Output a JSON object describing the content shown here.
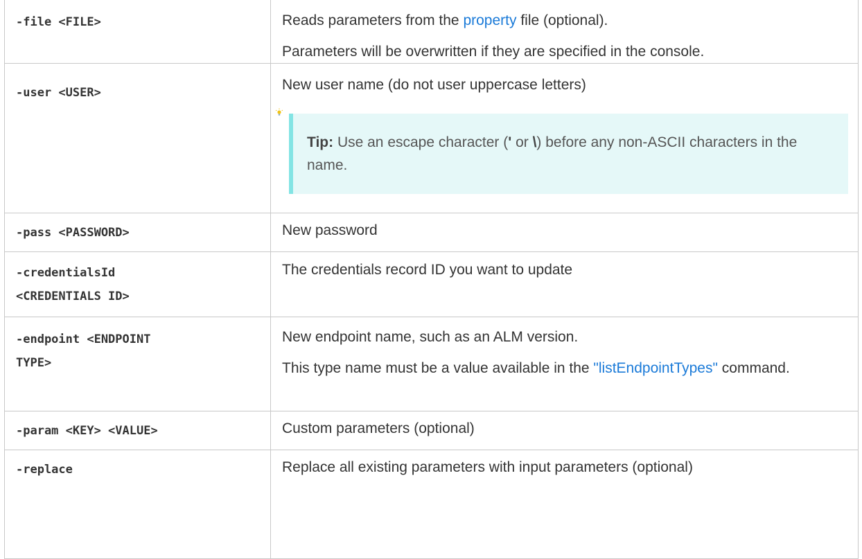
{
  "rows": [
    {
      "option": "-file <FILE>",
      "desc_parts": {
        "before": "Reads parameters from the ",
        "link": "property",
        "after": " file (optional)."
      },
      "desc2": "Parameters will be overwritten if they are specified in the console."
    },
    {
      "option": "-user <USER>",
      "desc": "New user name (do not user uppercase letters)",
      "tip": {
        "label": "Tip:",
        "text_before": " Use an escape character (",
        "char1": "'",
        "text_mid": " or ",
        "char2": "\\",
        "text_after": ") before any non-ASCII characters in the name.",
        "icon": "lightbulb-icon"
      }
    },
    {
      "option": "-pass <PASSWORD>",
      "desc": "New password"
    },
    {
      "option_line1": "-credentialsId",
      "option_line2": "<CREDENTIALS ID>",
      "desc": "The credentials record ID you want to update"
    },
    {
      "option_line1": "-endpoint <ENDPOINT",
      "option_line2": "TYPE>",
      "desc": "New endpoint name, such as an ALM version.",
      "desc2_parts": {
        "before": "This type name must be a value available in the ",
        "link": "\"listEndpointTypes\"",
        "after": " command."
      }
    },
    {
      "option": "-param <KEY> <VALUE>",
      "desc": "Custom parameters (optional)"
    },
    {
      "option": "-replace",
      "desc": "Replace all existing parameters with input parameters (optional)"
    }
  ],
  "colors": {
    "link": "#1a7ad8",
    "tip_background": "#e5f8f8",
    "tip_border": "#83e4e4",
    "border": "#c8c8c8"
  }
}
